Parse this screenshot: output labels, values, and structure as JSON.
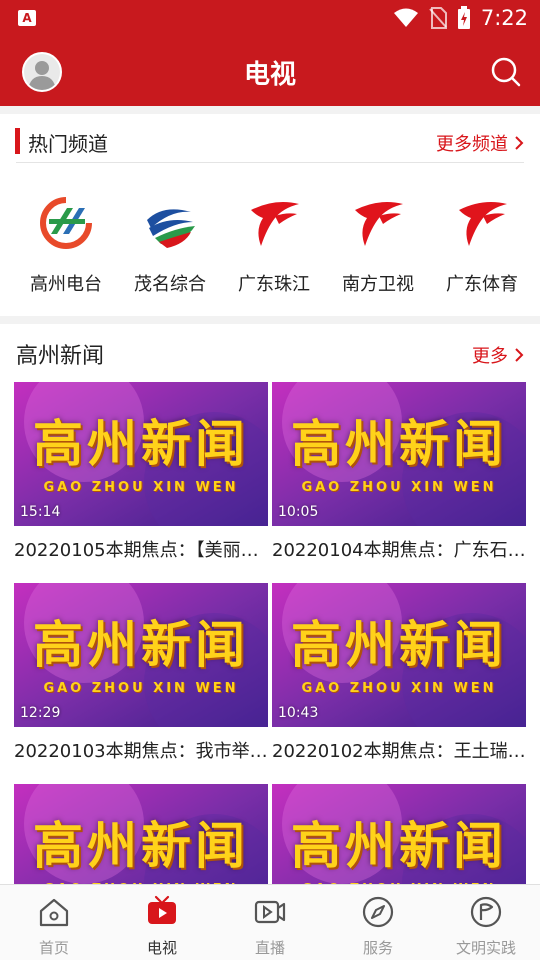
{
  "status_bar": {
    "time": "7:22",
    "app_icon_letter": "A"
  },
  "app_bar": {
    "title": "电视"
  },
  "hot_channels": {
    "title": "热门频道",
    "more": "更多频道",
    "items": [
      {
        "label": "高州电台",
        "icon": "gaozhou-radio-logo"
      },
      {
        "label": "茂名综合",
        "icon": "maoming-tv-logo"
      },
      {
        "label": "广东珠江",
        "icon": "guangdong-tv-logo"
      },
      {
        "label": "南方卫视",
        "icon": "guangdong-tv-logo"
      },
      {
        "label": "广东体育",
        "icon": "guangdong-tv-logo"
      }
    ]
  },
  "news": {
    "title": "高州新闻",
    "more": "更多",
    "thumbnail_title": "高州新闻",
    "thumbnail_subtitle": "GAO ZHOU XIN WEN",
    "items": [
      {
        "title": "20220105本期焦点：【美丽…",
        "duration": "15:14"
      },
      {
        "title": "20220104本期焦点：广东石…",
        "duration": "10:05"
      },
      {
        "title": "20220103本期焦点：我市举…",
        "duration": "12:29"
      },
      {
        "title": "20220102本期焦点：王土瑞…",
        "duration": "10:43"
      },
      {
        "title": "",
        "duration": ""
      },
      {
        "title": "",
        "duration": ""
      }
    ]
  },
  "bottom_nav": {
    "items": [
      {
        "label": "首页",
        "icon": "home-icon"
      },
      {
        "label": "电视",
        "icon": "tv-icon"
      },
      {
        "label": "直播",
        "icon": "live-video-icon"
      },
      {
        "label": "服务",
        "icon": "compass-icon"
      },
      {
        "label": "文明实践",
        "icon": "flag-circle-icon"
      }
    ],
    "active": "电视"
  },
  "colors": {
    "brand_red": "#c8191e",
    "accent_red": "#d8161b"
  }
}
